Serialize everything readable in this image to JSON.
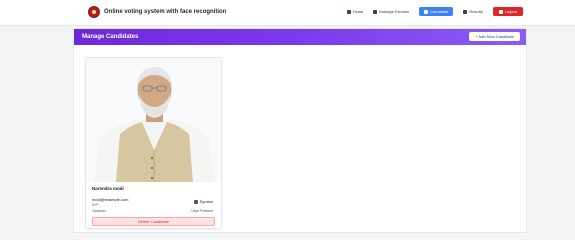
{
  "app": {
    "title": "Online voting system with face recognition"
  },
  "nav": {
    "links": [
      {
        "label": "Home",
        "icon": "home-icon"
      },
      {
        "label": "Manage Election",
        "icon": "ballot-icon"
      },
      {
        "label": "Candidate",
        "icon": "user-icon",
        "active": true
      },
      {
        "label": "Results",
        "icon": "chart-icon"
      }
    ],
    "logout": {
      "label": "Logout",
      "icon": "logout-icon"
    }
  },
  "page": {
    "title": "Manage Candidates",
    "add_button": "+ Add New Candidate"
  },
  "candidate": {
    "name": "Narendra modi",
    "email": "modi@example.com",
    "party": "BJP",
    "symbol_label": "Symbol",
    "region": "Varanasi",
    "state": "Uttar Pradesh",
    "delete_button": "Delete Candidate"
  },
  "colors": {
    "header_gradient_start": "#6d28d9",
    "header_gradient_end": "#8b5cf6",
    "active_nav": "#3b82f6",
    "logout": "#dc2626",
    "delete_bg": "#fee2e2",
    "delete_text": "#dc2626"
  }
}
